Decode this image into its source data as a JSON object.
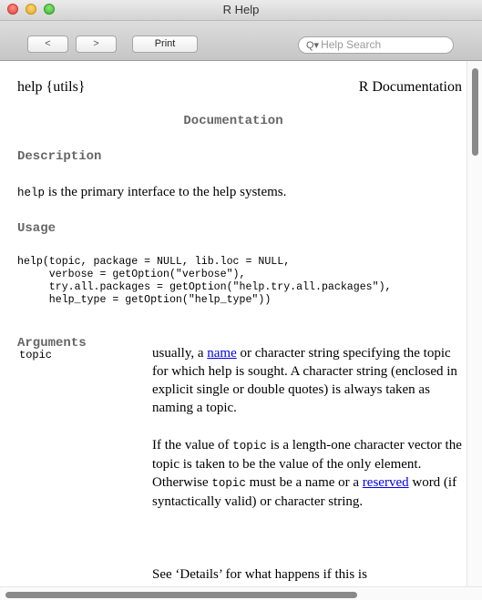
{
  "window": {
    "title": "R Help"
  },
  "toolbar": {
    "back_label": "<",
    "forward_label": ">",
    "print_label": "Print",
    "search_placeholder": "Help Search",
    "search_icon_glyph": "Q▾"
  },
  "doc": {
    "header_left": "help {utils}",
    "header_right": "R Documentation",
    "title": "Documentation",
    "description_heading": "Description",
    "description_code": "help",
    "description_text": " is the primary interface to the help systems.",
    "usage_heading": "Usage",
    "usage_code": "help(topic, package = NULL, lib.loc = NULL,\n     verbose = getOption(\"verbose\"),\n     try.all.packages = getOption(\"help.try.all.packages\"),\n     help_type = getOption(\"help_type\"))",
    "arguments_heading": "Arguments",
    "arg_topic": {
      "name": "topic",
      "p1_before": "usually, a ",
      "p1_link": "name",
      "p1_after": " or character string specifying the topic for which help is sought. A character string (enclosed in explicit single or double quotes) is always taken as naming a topic.",
      "p2_a": "If the value of ",
      "p2_code1": "topic",
      "p2_b": " is a length-one character vector the topic is taken to be the value of the only element. Otherwise ",
      "p2_code2": "topic",
      "p2_c": " must be a name or a ",
      "p2_link": "reserved",
      "p2_d": " word (if syntactically valid) or character string.",
      "p3": "See ‘Details’ for what happens if this is"
    }
  }
}
